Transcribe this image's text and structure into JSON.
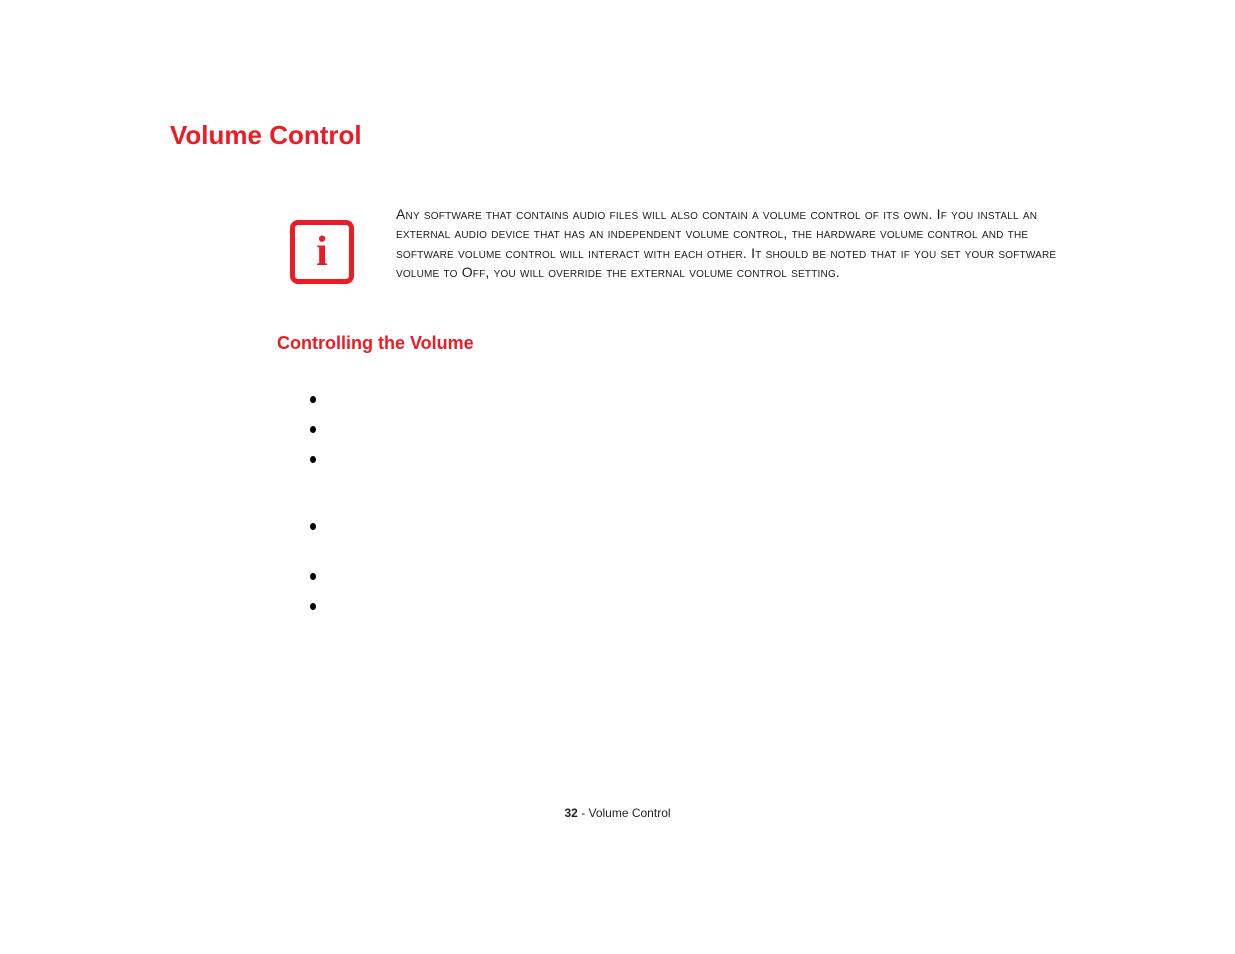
{
  "title": "Volume Control",
  "note": {
    "icon_glyph": "i",
    "text": "Any software that contains audio files will also contain a volume control of its own. If you install an external audio device that has an independent volume control, the hardware volume control and the software volume control will interact with each other. It should be noted that if you set your software volume to Off, you will override the external volume control setting."
  },
  "subheading": "Controlling the Volume",
  "bullets": [
    "",
    "",
    "",
    "",
    "",
    ""
  ],
  "footer": {
    "page_number": "32",
    "separator": " - ",
    "section": "Volume Control"
  }
}
